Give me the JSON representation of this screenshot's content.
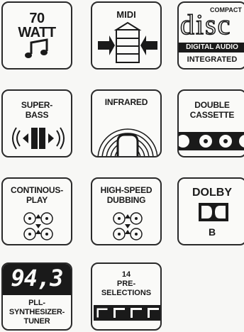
{
  "tiles": {
    "watt": {
      "number": "70",
      "unit": "WATT",
      "icon": "music-note-icon"
    },
    "midi": {
      "label": "MIDI",
      "icon": "stacked-components-arrows-icon"
    },
    "cd": {
      "top": "COMPACT",
      "logo": "disc",
      "mid": "DIGITAL AUDIO",
      "bottom": "INTEGRATED"
    },
    "superbass": {
      "line1": "SUPER-",
      "line2": "BASS",
      "icon": "speaker-arrows-icon"
    },
    "infrared": {
      "label": "INFRARED",
      "icon": "infrared-waves-icon"
    },
    "cassette": {
      "line1": "DOUBLE",
      "line2": "CASSETTE",
      "icon": "cassette-reels-icon"
    },
    "continous": {
      "line1": "CONTINOUS-",
      "line2": "PLAY",
      "icon": "reels-arrows-icon"
    },
    "dubbing": {
      "line1": "HIGH-SPEED",
      "line2": "DUBBING",
      "icon": "reels-arrows-icon"
    },
    "dolby": {
      "line1": "DOLBY",
      "line2": "B",
      "icon": "dolby-double-d-icon"
    },
    "tuner": {
      "display": "94,3",
      "line1": "PLL-",
      "line2": "SYNTHESIZER-",
      "line3": "TUNER"
    },
    "presets": {
      "line1": "14",
      "line2": "PRE-",
      "line3": "SELECTIONS",
      "icon": "preset-buttons-icon"
    }
  },
  "colors": {
    "ink": "#1a1a1a",
    "tile_bg": "#fafaf8",
    "display_bg": "#222222"
  }
}
